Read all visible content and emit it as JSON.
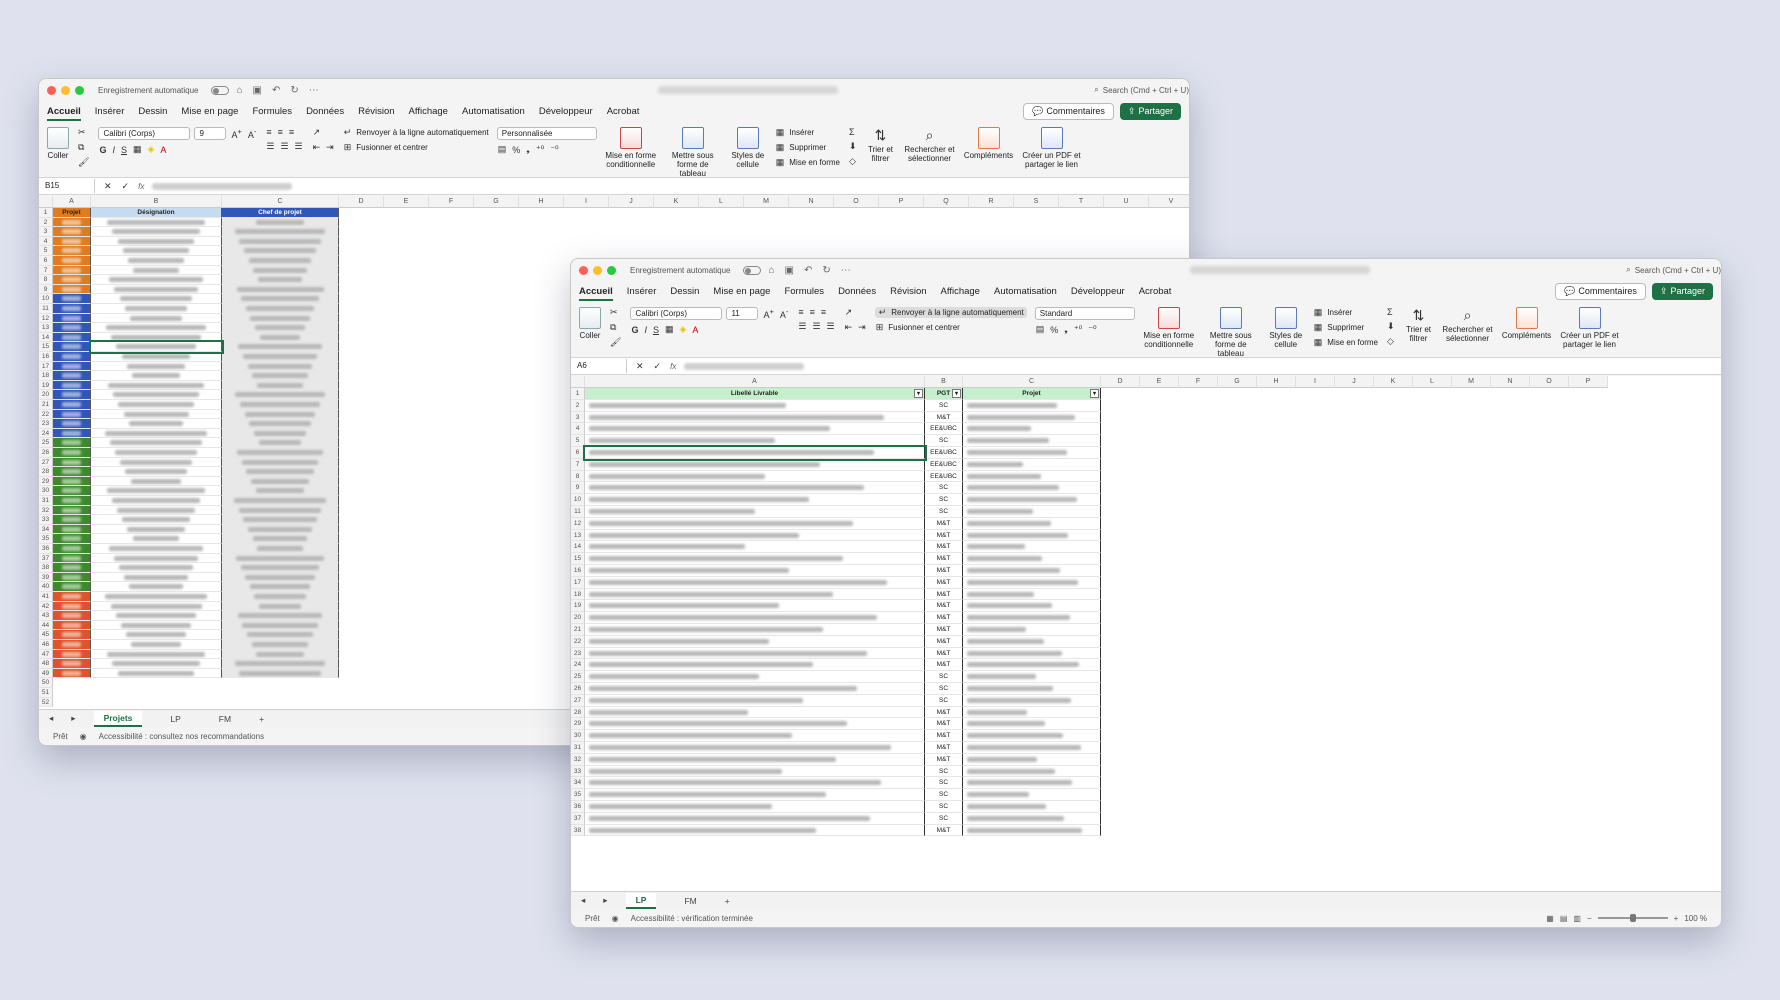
{
  "common": {
    "autosave_label": "Enregistrement automatique",
    "search_placeholder": "Search (Cmd + Ctrl + U)",
    "tabs": [
      "Accueil",
      "Insérer",
      "Dessin",
      "Mise en page",
      "Formules",
      "Données",
      "Révision",
      "Affichage",
      "Automatisation",
      "Développeur",
      "Acrobat"
    ],
    "comments_label": "Commentaires",
    "share_label": "Partager",
    "paste_label": "Coller",
    "wrap_label": "Renvoyer à la ligne automatiquement",
    "merge_label": "Fusionner et centrer",
    "insert_label": "Insérer",
    "delete_label": "Supprimer",
    "format_label": "Mise en forme",
    "cond_format_label": "Mise en forme conditionnelle",
    "table_format_label": "Mettre sous forme de tableau",
    "cell_styles_label": "Styles de cellule",
    "sort_label": "Trier et filtrer",
    "find_label": "Rechercher et sélectionner",
    "addins_label": "Compléments",
    "pdf_label": "Créer un PDF et partager le lien",
    "ready_label": "Prêt",
    "font_name": "Calibri (Corps)",
    "bold": "G",
    "italic": "I",
    "underline": "S"
  },
  "window1": {
    "font_size": "9",
    "number_format": "Personnalisée",
    "name_box": "B15",
    "columns": [
      "A",
      "B",
      "C",
      "D",
      "E",
      "F",
      "G",
      "H",
      "I",
      "J",
      "K",
      "L",
      "M",
      "N",
      "O",
      "P",
      "Q",
      "R",
      "S",
      "T",
      "U",
      "V"
    ],
    "headers": {
      "a": "Projet",
      "b": "Désignation",
      "c": "Chef de projet"
    },
    "sheet_tabs": [
      "Projets",
      "LP",
      "FM"
    ],
    "active_tab": "Projets",
    "accessibility": "Accessibilité : consultez nos recommandations",
    "row_groups": [
      {
        "from": 2,
        "to": 9,
        "color": "#e07b20"
      },
      {
        "from": 10,
        "to": 24,
        "color": "#2f56b8"
      },
      {
        "from": 25,
        "to": 40,
        "color": "#3d8a2e"
      },
      {
        "from": 41,
        "to": 49,
        "color": "#e0522a"
      }
    ]
  },
  "window2": {
    "font_size": "11",
    "number_format": "Standard",
    "name_box": "A6",
    "columns": [
      "A",
      "B",
      "C",
      "D",
      "E",
      "F",
      "G",
      "H",
      "I",
      "J",
      "K",
      "L",
      "M",
      "N",
      "O",
      "P"
    ],
    "headers": {
      "a": "Libellé Livrable",
      "b": "PGT",
      "c": "Projet"
    },
    "pgt": [
      "SC",
      "M&T",
      "EE&UBC",
      "SC",
      "EE&UBC",
      "EE&UBC",
      "EE&UBC",
      "SC",
      "SC",
      "SC",
      "M&T",
      "M&T",
      "M&T",
      "M&T",
      "M&T",
      "M&T",
      "M&T",
      "M&T",
      "M&T",
      "M&T",
      "M&T",
      "M&T",
      "M&T",
      "SC",
      "SC",
      "SC",
      "M&T",
      "M&T",
      "M&T",
      "M&T",
      "M&T",
      "SC",
      "SC",
      "SC",
      "SC",
      "SC",
      "M&T"
    ],
    "sheet_tabs": [
      "LP",
      "FM"
    ],
    "active_tab": "LP",
    "accessibility": "Accessibilité : vérification terminée",
    "zoom": "100 %"
  },
  "colors": {
    "green": "#1e7145",
    "header_green": "#c6efce",
    "header_blue": "#2f56b8",
    "header_lightblue": "#c5dcf0"
  }
}
